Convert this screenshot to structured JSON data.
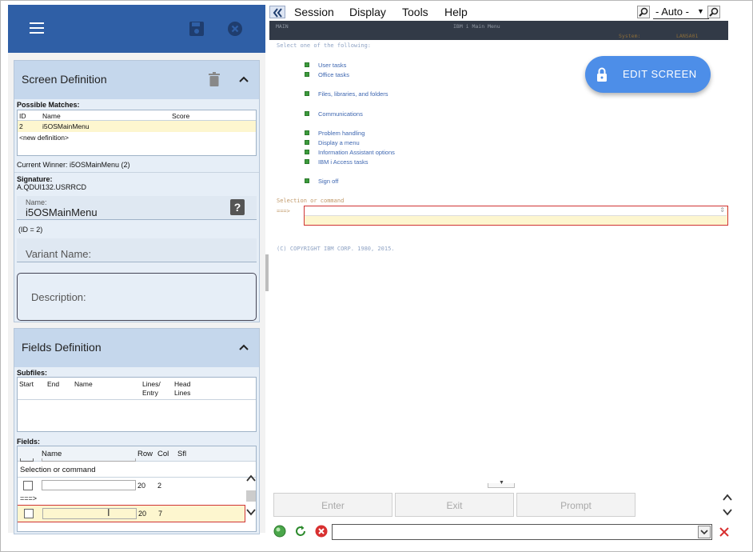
{
  "screen_def": {
    "title": "Screen Definition",
    "possible_matches_label": "Possible Matches:",
    "columns": {
      "id": "ID",
      "name": "Name",
      "score": "Score"
    },
    "rows": [
      {
        "id": "2",
        "name": "i5OSMainMenu",
        "score": ""
      }
    ],
    "new_def": "<new definition>",
    "current_winner": "Current Winner: i5OSMainMenu (2)",
    "signature_label": "Signature:",
    "signature_value": "A.QDUI132.USRRCD",
    "name_label": "Name:",
    "name_value": "i5OSMainMenu",
    "id_note": "(ID = 2)",
    "variant_label": "Variant Name:",
    "description_label": "Description:",
    "help_glyph": "?"
  },
  "fields_def": {
    "title": "Fields Definition",
    "subfiles_label": "Subfiles:",
    "subfile_columns": {
      "start": "Start",
      "end": "End",
      "name": "Name",
      "lines_entry_1": "Lines/",
      "lines_entry_2": "Entry",
      "head_lines_1": "Head",
      "head_lines_2": "Lines"
    },
    "fields_label": "Fields:",
    "field_columns": {
      "name": "Name",
      "row": "Row",
      "col": "Col",
      "sfl": "Sfl"
    },
    "group_label": "Selection or command",
    "rows": [
      {
        "row": "20",
        "col": "2"
      },
      {
        "row": "20",
        "col": "7"
      }
    ],
    "arrow_text": "===>"
  },
  "menubar": {
    "items": [
      "Session",
      "Display",
      "Tools",
      "Help"
    ],
    "auto_label": "- Auto -"
  },
  "terminal": {
    "header_left": "MAIN",
    "header_center": "IBM i Main Menu",
    "system_label": "System:",
    "system_value": "LANSA01",
    "select_prompt": "Select one of the following:",
    "options": [
      "User tasks",
      "Office tasks",
      "Files, libraries, and folders",
      "Communications",
      "Problem handling",
      "Display a menu",
      "Information Assistant options",
      "IBM i Access tasks",
      "Sign off"
    ],
    "selection_label": "Selection or command",
    "arrow_prompt": "===>",
    "copyright": "(C) COPYRIGHT IBM CORP. 1980, 2015."
  },
  "edit_button": "EDIT SCREEN",
  "fkeys": [
    "Enter",
    "Exit",
    "Prompt"
  ],
  "colors": {
    "topbar": "#2f5fa6",
    "section_head": "#c5d7ec",
    "accent_button": "#4d8ee8",
    "highlight_row": "#fdf6cf",
    "error_red": "#d03434"
  }
}
